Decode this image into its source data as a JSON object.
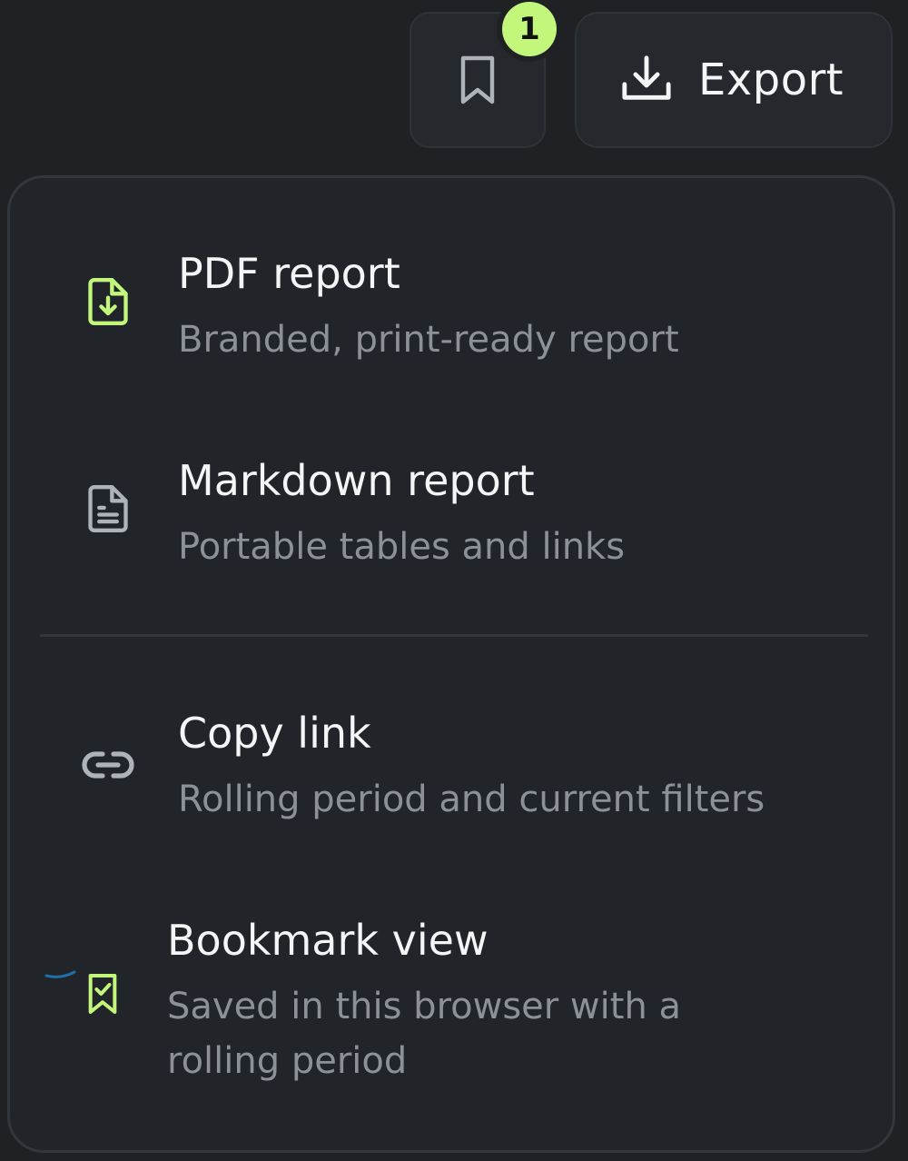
{
  "header": {
    "bookmark_badge": "1",
    "export_label": "Export"
  },
  "colors": {
    "accent": "#c3f77c",
    "icon_muted": "#aeb3ba",
    "text_primary": "#f4f5f7",
    "text_secondary": "#8c9198",
    "background": "#1f2125",
    "focus": "#1e6fa8"
  },
  "menu": {
    "items": [
      {
        "title": "PDF report",
        "description": "Branded, print-ready report",
        "icon": "file-download-icon"
      },
      {
        "title": "Markdown report",
        "description": "Portable tables and links",
        "icon": "file-text-icon"
      },
      {
        "title": "Copy link",
        "description": "Rolling period and current filters",
        "icon": "link-icon"
      },
      {
        "title": "Bookmark view",
        "description": "Saved in this browser with a rolling period",
        "icon": "bookmark-check-icon"
      }
    ]
  }
}
